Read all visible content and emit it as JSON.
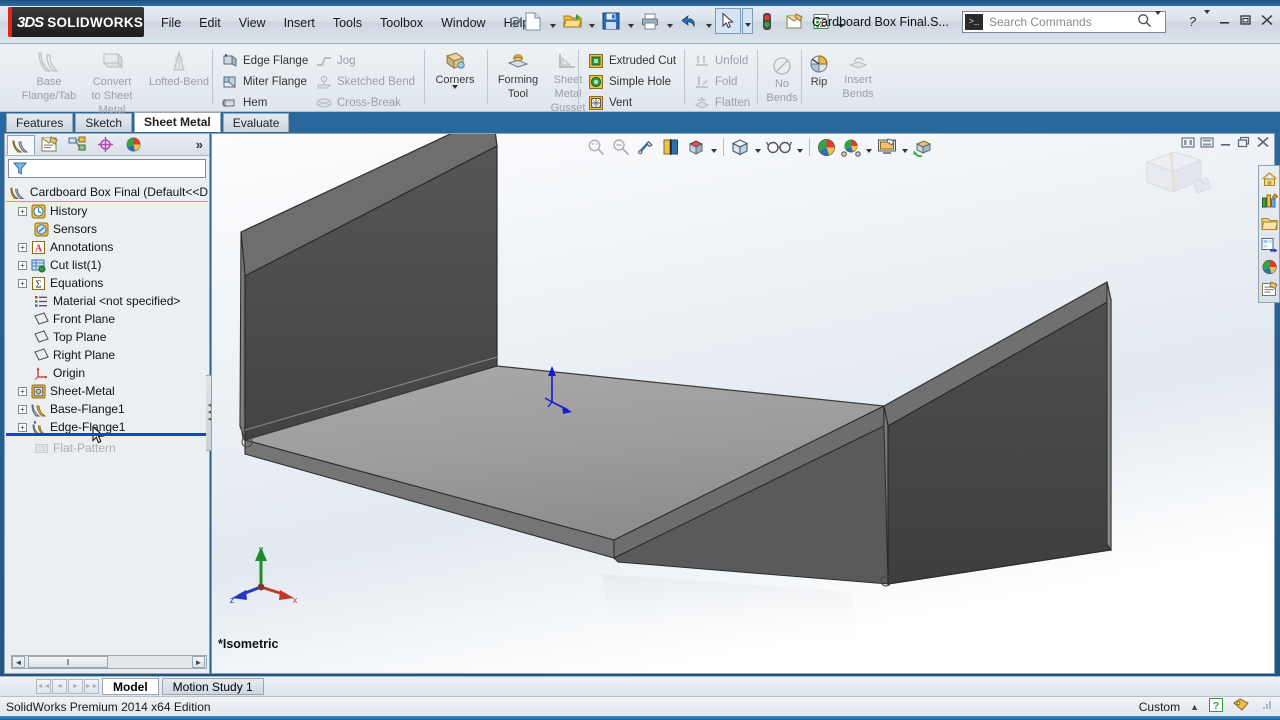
{
  "app": {
    "brand_primary": "SOLIDWORKS",
    "brand_mark": "3DS",
    "document_title": "Cardboard Box Final.S...",
    "edition": "SolidWorks Premium 2014 x64 Edition",
    "accent": "#e1261c"
  },
  "menu": {
    "items": [
      {
        "label": "File"
      },
      {
        "label": "Edit"
      },
      {
        "label": "View"
      },
      {
        "label": "Insert"
      },
      {
        "label": "Tools"
      },
      {
        "label": "Toolbox"
      },
      {
        "label": "Window"
      },
      {
        "label": "Help"
      }
    ]
  },
  "quick_access": {
    "buttons": [
      {
        "name": "new-document",
        "icon": "new-doc-icon",
        "has_dropdown": true
      },
      {
        "name": "open-document",
        "icon": "open-folder-icon",
        "has_dropdown": true
      },
      {
        "name": "save-document",
        "icon": "save-disk-icon",
        "has_dropdown": true
      },
      {
        "name": "print-document",
        "icon": "printer-icon",
        "has_dropdown": true
      },
      {
        "name": "undo",
        "icon": "undo-arrow-icon",
        "has_dropdown": true
      },
      {
        "name": "select",
        "icon": "cursor-arrow-icon",
        "has_dropdown": true
      },
      {
        "name": "rebuild",
        "icon": "traffic-light-icon",
        "has_dropdown": false
      },
      {
        "name": "options",
        "icon": "gear-options-icon",
        "has_dropdown": false
      },
      {
        "name": "document-properties",
        "icon": "list-properties-icon",
        "has_dropdown": true
      }
    ]
  },
  "search": {
    "placeholder": "Search Commands",
    "prompt_glyph": ">_"
  },
  "window_controls": {
    "help": "?",
    "minimize": "minimize-icon",
    "restore": "restore-icon",
    "close": "close-icon"
  },
  "ribbon": {
    "groups": [
      {
        "name": "flange-group",
        "big_buttons": [
          {
            "label": "Base\nFlange/Tab",
            "label_lines": [
              "Base",
              "Flange/Tab"
            ],
            "icon": "base-flange-icon",
            "disabled": true
          },
          {
            "label": "Convert to Sheet Metal",
            "label_lines": [
              "Convert",
              "to Sheet",
              "Metal"
            ],
            "icon": "convert-sheet-metal-icon",
            "disabled": true
          },
          {
            "label": "Lofted-Bend",
            "label_lines": [
              "Lofted-Bend"
            ],
            "icon": "lofted-bend-icon",
            "disabled": true
          }
        ]
      },
      {
        "name": "edge-flange-group",
        "small_items": [
          {
            "label": "Edge Flange",
            "icon": "edge-flange-icon",
            "disabled": false
          },
          {
            "label": "Miter Flange",
            "icon": "miter-flange-icon",
            "disabled": false
          },
          {
            "label": "Hem",
            "icon": "hem-icon",
            "disabled": false
          },
          {
            "label": "Jog",
            "icon": "jog-icon",
            "disabled": true
          },
          {
            "label": "Sketched Bend",
            "icon": "sketched-bend-icon",
            "disabled": true
          },
          {
            "label": "Cross-Break",
            "icon": "cross-break-icon",
            "disabled": true
          }
        ]
      },
      {
        "name": "corners-group",
        "big_buttons": [
          {
            "label": "Corners",
            "label_lines": [
              "Corners"
            ],
            "icon": "corners-icon",
            "disabled": false,
            "has_dropdown": true
          }
        ]
      },
      {
        "name": "forming-group",
        "big_buttons": [
          {
            "label": "Forming Tool",
            "label_lines": [
              "Forming",
              "Tool"
            ],
            "icon": "forming-tool-icon",
            "disabled": false
          },
          {
            "label": "Sheet Metal Gusset",
            "label_lines": [
              "Sheet",
              "Metal",
              "Gusset"
            ],
            "icon": "sheet-metal-gusset-icon",
            "disabled": true
          }
        ]
      },
      {
        "name": "cut-group",
        "small_items": [
          {
            "label": "Extruded Cut",
            "icon": "extruded-cut-icon",
            "disabled": false
          },
          {
            "label": "Simple Hole",
            "icon": "simple-hole-icon",
            "disabled": false
          },
          {
            "label": "Vent",
            "icon": "vent-icon",
            "disabled": false
          }
        ]
      },
      {
        "name": "fold-group",
        "small_items": [
          {
            "label": "Unfold",
            "icon": "unfold-icon",
            "disabled": true
          },
          {
            "label": "Fold",
            "icon": "fold-icon",
            "disabled": true
          },
          {
            "label": "Flatten",
            "icon": "flatten-icon",
            "disabled": true
          }
        ]
      },
      {
        "name": "bends-group",
        "big_buttons": [
          {
            "label": "No Bends",
            "label_lines": [
              "No",
              "Bends"
            ],
            "icon": "no-bends-icon",
            "disabled": true
          }
        ]
      },
      {
        "name": "rip-group",
        "big_buttons": [
          {
            "label": "Rip",
            "label_lines": [
              "Rip"
            ],
            "icon": "rip-icon",
            "disabled": false
          },
          {
            "label": "Insert Bends",
            "label_lines": [
              "Insert",
              "Bends"
            ],
            "icon": "insert-bends-icon",
            "disabled": true
          }
        ]
      }
    ]
  },
  "command_tabs": {
    "tabs": [
      {
        "label": "Features",
        "active": false
      },
      {
        "label": "Sketch",
        "active": false
      },
      {
        "label": "Sheet Metal",
        "active": true
      },
      {
        "label": "Evaluate",
        "active": false
      }
    ]
  },
  "left_panel": {
    "tabs": [
      {
        "name": "feature-manager-tab",
        "icon": "feature-tree-icon",
        "active": true
      },
      {
        "name": "property-manager-tab",
        "icon": "property-manager-icon",
        "active": false
      },
      {
        "name": "configuration-manager-tab",
        "icon": "configuration-icon",
        "active": false
      },
      {
        "name": "dimxpert-manager-tab",
        "icon": "dimxpert-icon",
        "active": false
      },
      {
        "name": "display-manager-tab",
        "icon": "display-manager-icon",
        "active": false
      }
    ],
    "more_label": "»",
    "filter": {
      "placeholder": "",
      "icon": "filter-funnel-icon"
    },
    "scroll": {
      "left_arrow": "◄",
      "right_arrow": "►",
      "thumb_grip": "‖"
    },
    "tree": {
      "root": {
        "label": "Cardboard Box Final  (Default<<D",
        "icon": "part-document-icon"
      },
      "nodes": [
        {
          "label": "History",
          "icon": "history-icon",
          "expandable": true,
          "greyed": false
        },
        {
          "label": "Sensors",
          "icon": "sensors-icon",
          "expandable": false,
          "greyed": false
        },
        {
          "label": "Annotations",
          "icon": "annotations-icon",
          "expandable": true,
          "greyed": false
        },
        {
          "label": "Cut list(1)",
          "icon": "cut-list-icon",
          "expandable": true,
          "greyed": false
        },
        {
          "label": "Equations",
          "icon": "equations-icon",
          "expandable": true,
          "greyed": false
        },
        {
          "label": "Material <not specified>",
          "icon": "material-icon",
          "expandable": false,
          "greyed": false
        },
        {
          "label": "Front Plane",
          "icon": "plane-icon",
          "expandable": false,
          "greyed": false
        },
        {
          "label": "Top Plane",
          "icon": "plane-icon",
          "expandable": false,
          "greyed": false
        },
        {
          "label": "Right Plane",
          "icon": "plane-icon",
          "expandable": false,
          "greyed": false
        },
        {
          "label": "Origin",
          "icon": "origin-icon",
          "expandable": false,
          "greyed": false
        },
        {
          "label": "Sheet-Metal",
          "icon": "sheet-metal-feature-icon",
          "expandable": true,
          "greyed": false
        },
        {
          "label": "Base-Flange1",
          "icon": "base-flange-feature-icon",
          "expandable": true,
          "greyed": false
        },
        {
          "label": "Edge-Flange1",
          "icon": "edge-flange-feature-icon",
          "expandable": true,
          "greyed": false
        },
        {
          "label": "Flat-Pattern",
          "icon": "flat-pattern-icon",
          "expandable": false,
          "greyed": true
        }
      ],
      "rollback_after": "Edge-Flange1",
      "rollback_color": "#1744c8"
    }
  },
  "graphics": {
    "view_label": "*Isometric",
    "triad": {
      "x_label": "x",
      "y_label": "y",
      "z_label": "z",
      "x_color": "#cc2222",
      "y_color": "#118822",
      "z_color": "#2233cc"
    },
    "origin_marker": {
      "color": "#1a1ad0"
    },
    "model": {
      "name": "sheet-metal-u-channel",
      "top_face_color": "#9a9a9a",
      "side_face_color": "#4a4a4a",
      "edge_color": "#2b2b2b"
    },
    "hud_buttons": [
      {
        "name": "zoom-to-fit",
        "icon": "zoom-fit-icon",
        "disabled": true
      },
      {
        "name": "zoom-to-area",
        "icon": "zoom-area-icon",
        "disabled": true
      },
      {
        "name": "previous-view",
        "icon": "previous-view-icon",
        "disabled": false
      },
      {
        "name": "section-view",
        "icon": "section-view-icon",
        "disabled": false
      },
      {
        "name": "view-orientation",
        "icon": "view-orientation-icon",
        "disabled": false,
        "has_dropdown": true
      },
      {
        "name": "display-style",
        "icon": "display-style-cube-icon",
        "disabled": false,
        "has_dropdown": true
      },
      {
        "name": "hide-show-items",
        "icon": "glasses-icon",
        "disabled": false,
        "has_dropdown": true
      },
      {
        "name": "edit-appearance",
        "icon": "appearance-sphere-icon",
        "disabled": false
      },
      {
        "name": "apply-scene",
        "icon": "scene-icon",
        "disabled": false,
        "has_dropdown": true
      },
      {
        "name": "view-settings",
        "icon": "view-settings-icon",
        "disabled": false,
        "has_dropdown": true
      },
      {
        "name": "rotate-view",
        "icon": "rotate-view-icon",
        "disabled": false
      }
    ],
    "window_buttons": [
      {
        "name": "tile-horizontal",
        "icon": "tile-h-icon"
      },
      {
        "name": "tile-vertical",
        "icon": "tile-v-icon"
      },
      {
        "name": "minimize-doc",
        "icon": "minimize-icon"
      },
      {
        "name": "restore-doc",
        "icon": "restore-icon"
      },
      {
        "name": "close-doc",
        "icon": "close-icon"
      }
    ]
  },
  "task_pane": {
    "buttons": [
      {
        "name": "solidworks-resources",
        "icon": "home-icon"
      },
      {
        "name": "design-library",
        "icon": "design-library-icon"
      },
      {
        "name": "file-explorer",
        "icon": "folder-icon"
      },
      {
        "name": "view-palette",
        "icon": "view-palette-icon"
      },
      {
        "name": "appearances-scenes",
        "icon": "appearance-sphere-icon"
      },
      {
        "name": "custom-properties",
        "icon": "custom-properties-icon"
      }
    ]
  },
  "bottom_tabs": {
    "nav": [
      "◄◄",
      "◄",
      "►",
      "►►"
    ],
    "tabs": [
      {
        "label": "Model",
        "active": true
      },
      {
        "label": "Motion Study 1",
        "active": false
      }
    ]
  },
  "status_bar": {
    "message": "SolidWorks Premium 2014 x64 Edition",
    "units": "Custom",
    "units_caret": "▲",
    "help_badge": "?",
    "tag_icon": "tag-icon"
  }
}
